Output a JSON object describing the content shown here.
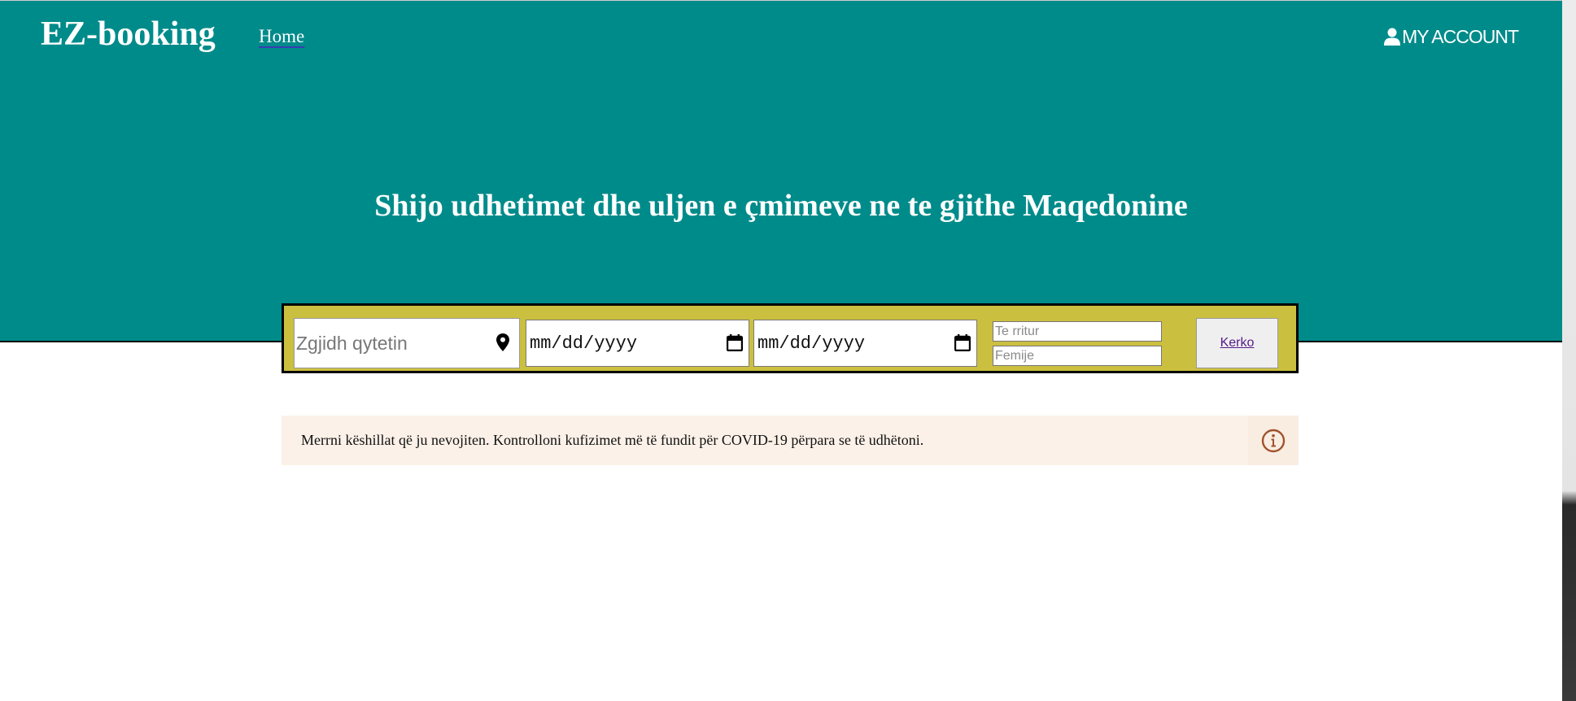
{
  "header": {
    "brand": "EZ-booking",
    "nav_home": "Home",
    "account": "MY ACCOUNT"
  },
  "hero": {
    "title": "Shijo udhetimet dhe uljen e çmimeve ne te gjithe Maqedonine"
  },
  "search": {
    "city_placeholder": "Zgjidh qytetin",
    "checkin_value": "mm/dd/yyyy",
    "checkout_value": "mm/dd/yyyy",
    "adults_placeholder": "Te rritur",
    "kids_placeholder": "Femije",
    "button_label": "Kerko"
  },
  "notice": {
    "text": "Merrni këshillat që ju nevojiten. Kontrolloni kufizimet më të fundit për COVID-19 përpara se të udhëtoni."
  },
  "colors": {
    "hero_bg": "#008b8b",
    "search_bar_bg": "#cbbf40",
    "notice_bg": "#fbf1e8",
    "info_icon": "#a0522d"
  },
  "icons": {
    "account": "user-icon",
    "city": "map-pin-icon",
    "date": "calendar-icon",
    "notice": "info-icon"
  }
}
